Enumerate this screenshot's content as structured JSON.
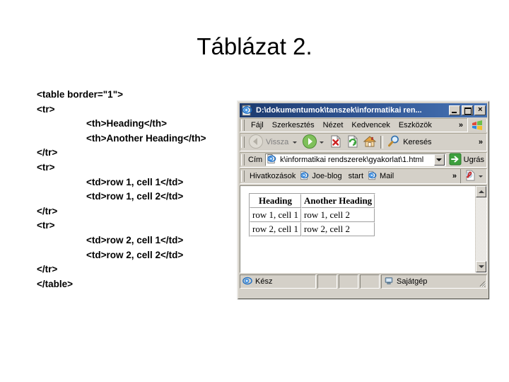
{
  "slide": {
    "title": "Táblázat 2.",
    "code_lines": [
      {
        "indent": 0,
        "text": "<table border=\"1\">"
      },
      {
        "indent": 0,
        "text": "<tr>"
      },
      {
        "indent": 1,
        "text": "<th>Heading</th>"
      },
      {
        "indent": 1,
        "text": "<th>Another Heading</th>"
      },
      {
        "indent": 0,
        "text": "</tr>"
      },
      {
        "indent": 0,
        "text": "<tr>"
      },
      {
        "indent": 1,
        "text": "<td>row 1, cell 1</td>"
      },
      {
        "indent": 1,
        "text": "<td>row 1, cell 2</td>"
      },
      {
        "indent": 0,
        "text": "</tr>"
      },
      {
        "indent": 0,
        "text": "<tr>"
      },
      {
        "indent": 1,
        "text": "<td>row 2, cell 1</td>"
      },
      {
        "indent": 1,
        "text": "<td>row 2, cell 2</td>"
      },
      {
        "indent": 0,
        "text": "</tr>"
      },
      {
        "indent": 0,
        "text": "</table>"
      }
    ]
  },
  "browser": {
    "title_bar": {
      "title": "D:\\dokumentumok\\tanszek\\informatikai ren...",
      "icon": "internet-explorer-icon",
      "minimize_label": "_",
      "maximize_label": "□",
      "close_label": "×"
    },
    "menu_bar": {
      "items": [
        {
          "label": "Fájl",
          "accel": "F"
        },
        {
          "label": "Szerkesztés",
          "accel": "z"
        },
        {
          "label": "Nézet",
          "accel": "N"
        },
        {
          "label": "Kedvencek",
          "accel": "v"
        },
        {
          "label": "Eszközök",
          "accel": "E"
        }
      ],
      "overflow": "»",
      "logo": "windows-flag-logo"
    },
    "toolbar": {
      "back_label": "Vissza",
      "back_enabled": false,
      "forward_label": "",
      "stop_icon": "stop-icon",
      "refresh_icon": "refresh-icon",
      "home_icon": "home-icon",
      "search_label": "Keresés",
      "overflow": "»"
    },
    "address_bar": {
      "label": "Cím",
      "icon": "internet-explorer-icon",
      "url": "k\\informatikai rendszerek\\gyakorlat\\1.html",
      "dropdown": "▼",
      "go_label": "Ugrás"
    },
    "links_bar": {
      "title": "Hivatkozások",
      "items": [
        {
          "label": "Joe-blog",
          "icon": "internet-explorer-icon"
        },
        {
          "label": "start",
          "icon": ""
        },
        {
          "label": "Mail",
          "icon": "internet-explorer-icon"
        }
      ],
      "overflow": "»",
      "pdf_icon": "acrobat-pdf-icon",
      "pdf_dropdown": "▼"
    },
    "page": {
      "table": {
        "headers": [
          "Heading",
          "Another Heading"
        ],
        "rows": [
          [
            "row 1, cell 1",
            "row 1, cell 2"
          ],
          [
            "row 2, cell 1",
            "row 2, cell 2"
          ]
        ]
      }
    },
    "status_bar": {
      "status_text": "Kész",
      "status_icon": "internet-explorer-icon",
      "zone_text": "Sajátgép",
      "zone_icon": "my-computer-icon"
    },
    "colors": {
      "title_bar_start": "#1c3a6e",
      "title_bar_end": "#4673b4",
      "chrome": "#d4d0c8",
      "page_background": "#ffffff"
    }
  }
}
